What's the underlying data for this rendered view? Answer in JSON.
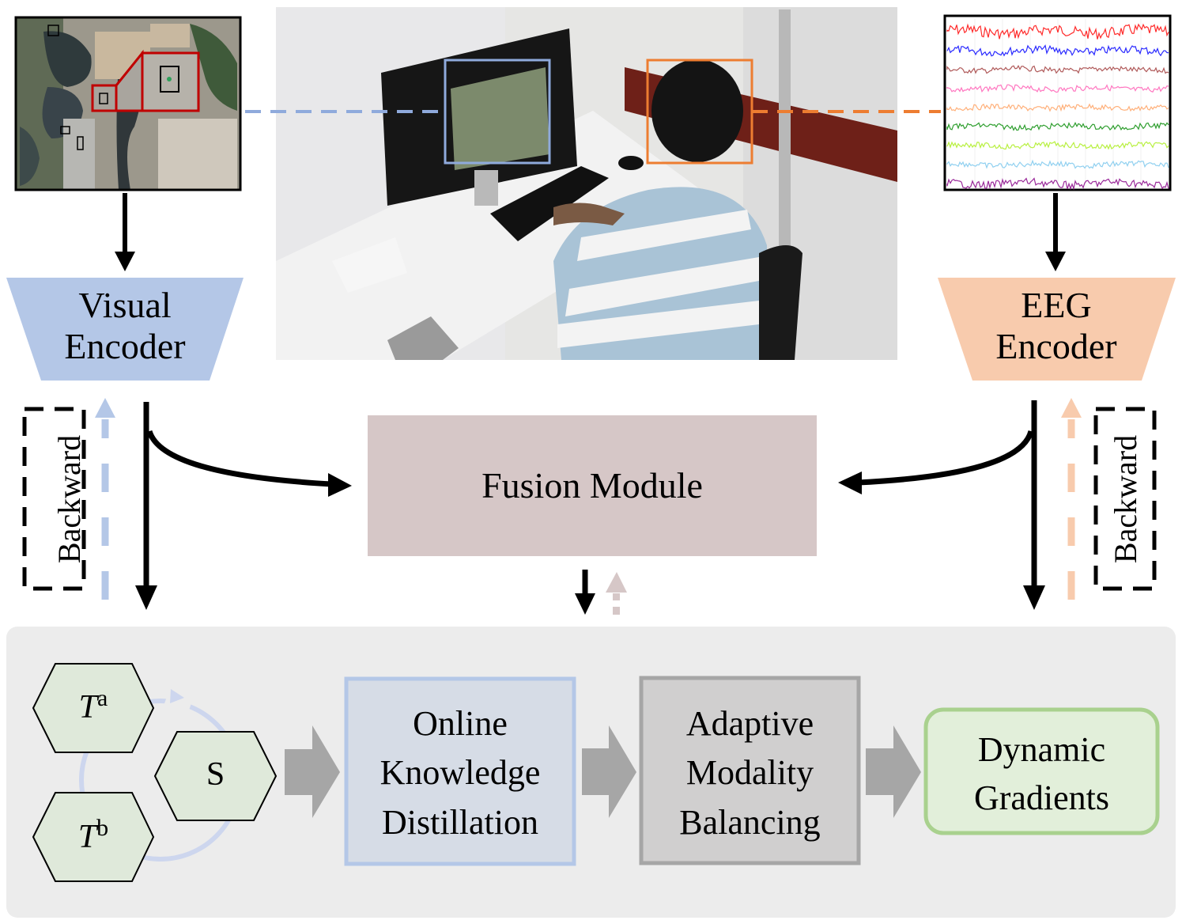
{
  "figure": {
    "inputs": {
      "aerial_image": {
        "name": "aerial-remote-sensing-image",
        "frame_color": "#000000",
        "highlight_color": "#c00000"
      },
      "experiment_photo": {
        "name": "eeg-experiment-photo",
        "screen_box_color": "#8faadc",
        "head_box_color": "#ed7d31"
      },
      "eeg_signals": {
        "name": "eeg-signal-traces",
        "channel_colors": [
          "#ff2a2a",
          "#2a2aff",
          "#b05a5a",
          "#ff77c0",
          "#ffb07a",
          "#2e9e2e",
          "#b8f040",
          "#90d0f0",
          "#9a2a9a"
        ]
      }
    },
    "encoders": {
      "visual": {
        "line1": "Visual",
        "line2": "Encoder",
        "color": "#b4c7e7"
      },
      "eeg": {
        "line1": "EEG",
        "line2": "Encoder",
        "color": "#f8cbad"
      }
    },
    "backward_left": {
      "label": "Backward",
      "arrow_color": "#b4c7e7"
    },
    "backward_right": {
      "label": "Backward",
      "arrow_color": "#f8cbad"
    },
    "fusion": {
      "label": "Fusion Module",
      "color": "#d6c7c7",
      "backward_arrow_color": "#d6c7c7"
    },
    "pipeline": {
      "panel_color": "#ececec",
      "hexagons": [
        {
          "label": "T",
          "sup": "a"
        },
        {
          "label": "S",
          "sup": ""
        },
        {
          "label": "T",
          "sup": "b"
        }
      ],
      "hex_fill": "#dfe9da",
      "cycle_color": "#cdd6ee",
      "steps": [
        {
          "line1": "Online",
          "line2": "Knowledge",
          "line3": "Distillation",
          "fill": "#d6dce6",
          "border": "#b4c7e7"
        },
        {
          "line1": "Adaptive",
          "line2": "Modality",
          "line3": "Balancing",
          "fill": "#d0cfcf",
          "border": "#a6a6a6"
        },
        {
          "line1": "Dynamic",
          "line2": "Gradients",
          "fill": "#e2efda",
          "border": "#a9d18e"
        }
      ],
      "flow_arrow_color": "#a6a6a6"
    }
  }
}
